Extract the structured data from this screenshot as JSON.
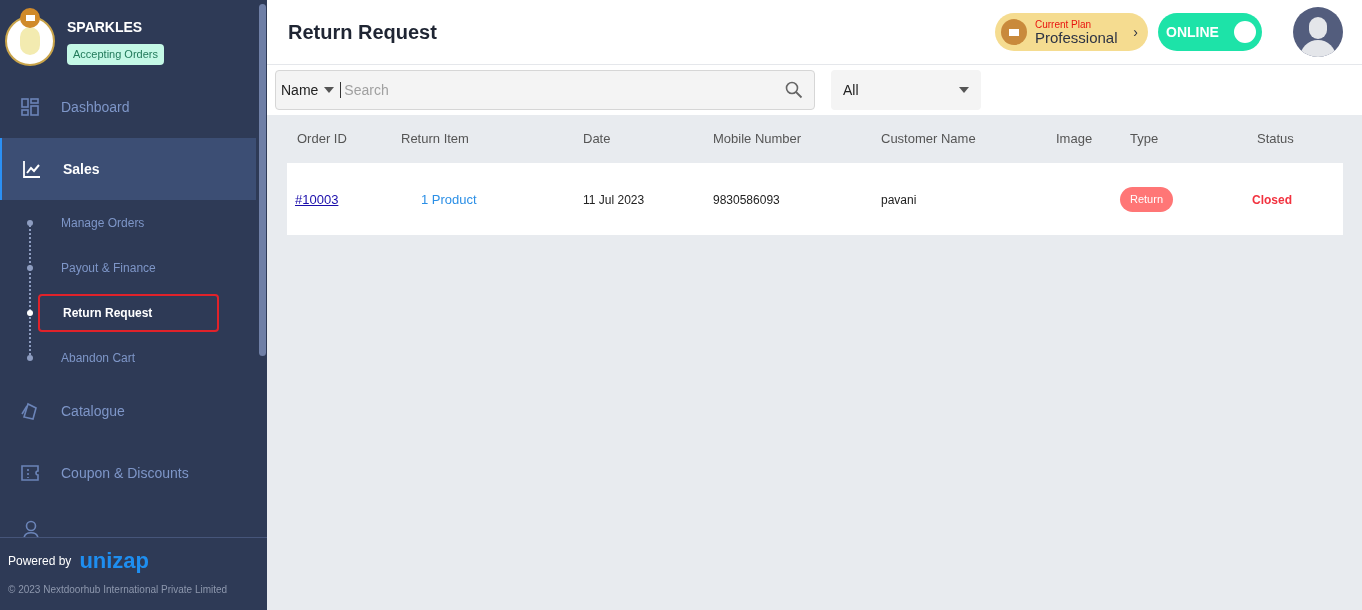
{
  "store": {
    "name": "SPARKLES",
    "badge": "Accepting Orders"
  },
  "nav": [
    {
      "label": "Dashboard",
      "selected": false
    },
    {
      "label": "Sales",
      "selected": true,
      "expanded": true,
      "children": [
        {
          "label": "Manage Orders",
          "selected": false
        },
        {
          "label": "Payout & Finance",
          "selected": false
        },
        {
          "label": "Return Request",
          "selected": true
        },
        {
          "label": "Abandon Cart",
          "selected": false
        }
      ]
    },
    {
      "label": "Catalogue",
      "selected": false
    },
    {
      "label": "Coupon & Discounts",
      "selected": false
    }
  ],
  "footer": {
    "powered_by": "Powered by",
    "brand": "unizap",
    "copyright": "© 2023 Nextdoorhub International Private Limited"
  },
  "page_title": "Return Request",
  "plan": {
    "caption": "Current Plan",
    "name": "Professional",
    "arrow": "›"
  },
  "online": {
    "label": "ONLINE",
    "on": true
  },
  "search": {
    "field": "Name",
    "placeholder": "Search"
  },
  "filter": {
    "value": "All"
  },
  "table": {
    "columns": [
      "Order ID",
      "Return Item",
      "Date",
      "Mobile Number",
      "Customer Name",
      "Image",
      "Type",
      "Status"
    ],
    "rows": [
      {
        "order_id": "#10003",
        "return_item": "1 Product",
        "date": "11 Jul 2023",
        "mobile": "9830586093",
        "customer": "pavani",
        "type": "Return",
        "status": "Closed"
      }
    ]
  }
}
